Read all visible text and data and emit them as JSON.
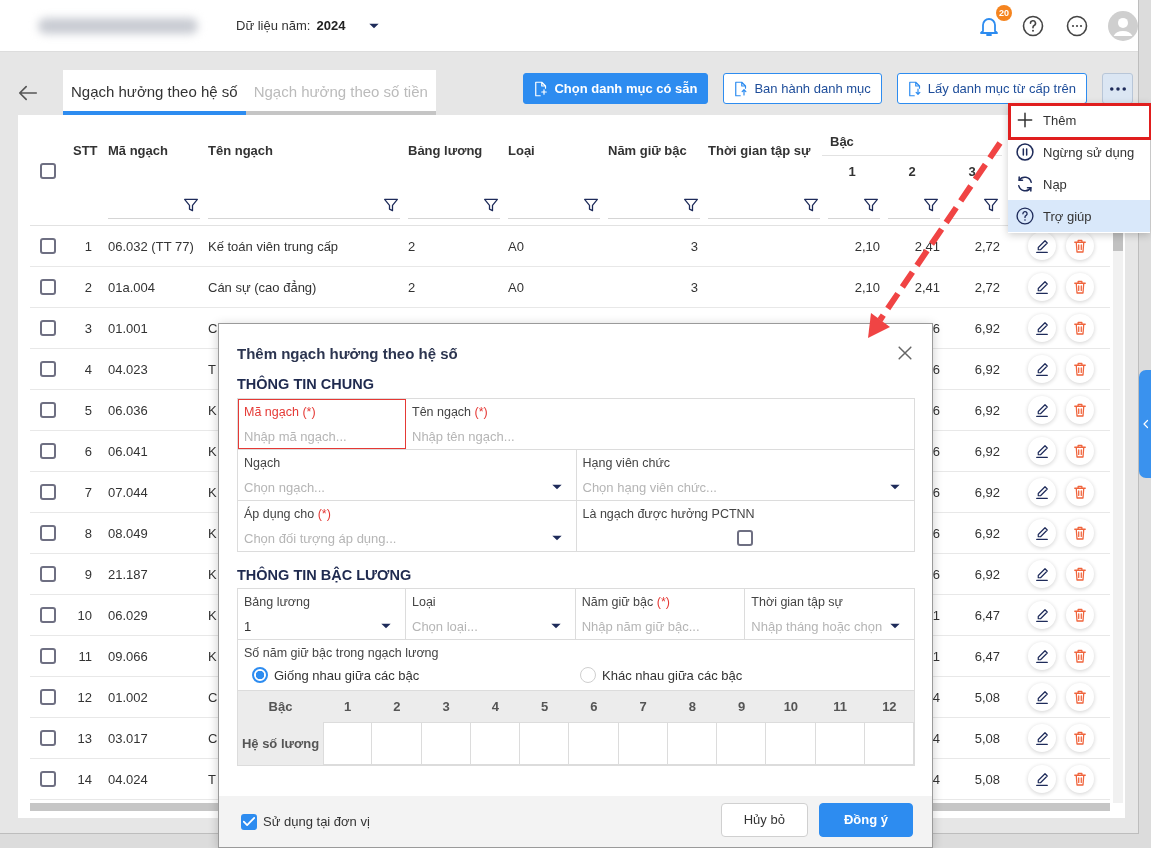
{
  "header": {
    "year_label": "Dữ liệu năm:",
    "year": "2024",
    "notification_count": "20"
  },
  "toolbar": {
    "tabs": [
      {
        "label": "Ngạch hưởng theo hệ số",
        "selected": true
      },
      {
        "label": "Ngạch hưởng theo số tiền",
        "selected": false
      }
    ],
    "buttons": [
      {
        "label": "Chọn danh mục có sẵn",
        "kind": "primary"
      },
      {
        "label": "Ban hành danh mục",
        "kind": "outline"
      },
      {
        "label": "Lấy danh mục từ cấp trên",
        "kind": "outline"
      }
    ]
  },
  "more_menu": {
    "items": [
      {
        "label": "Thêm",
        "hovered": false,
        "annotated": true
      },
      {
        "label": "Ngừng sử dụng",
        "hovered": false,
        "annotated": false
      },
      {
        "label": "Nạp",
        "hovered": false,
        "annotated": false
      },
      {
        "label": "Trợ giúp",
        "hovered": true,
        "annotated": false
      }
    ]
  },
  "table": {
    "select_all_checked": false,
    "columns": [
      "STT",
      "Mã ngạch",
      "Tên ngạch",
      "Bảng lương",
      "Loại",
      "Năm giữ bậc",
      "Thời gian tập sự"
    ],
    "step_header": "Bậc",
    "steps": [
      "1",
      "2",
      "3"
    ],
    "rows": [
      {
        "checked": false,
        "stt": "1",
        "code": "06.032 (TT 77)",
        "name": "Kế toán viên trung cấp",
        "salary_table": "2",
        "type": "A0",
        "years": "3",
        "step_1": "2,10",
        "step_2": "2,41",
        "step_3": "2,72"
      },
      {
        "checked": false,
        "stt": "2",
        "code": "01a.004",
        "name": "Cán sự (cao đẳng)",
        "salary_table": "2",
        "type": "A0",
        "years": "3",
        "step_1": "2,10",
        "step_2": "2,41",
        "step_3": "2,72"
      },
      {
        "checked": false,
        "stt": "3",
        "code": "01.001",
        "name": "C",
        "step_2": "6",
        "step_3": "6,92"
      },
      {
        "checked": false,
        "stt": "4",
        "code": "04.023",
        "name": "T",
        "step_2": "6",
        "step_3": "6,92"
      },
      {
        "checked": false,
        "stt": "5",
        "code": "06.036",
        "name": "K",
        "step_2": "6",
        "step_3": "6,92"
      },
      {
        "checked": false,
        "stt": "6",
        "code": "06.041",
        "name": "K",
        "step_2": "6",
        "step_3": "6,92"
      },
      {
        "checked": false,
        "stt": "7",
        "code": "07.044",
        "name": "K",
        "step_2": "6",
        "step_3": "6,92"
      },
      {
        "checked": false,
        "stt": "8",
        "code": "08.049",
        "name": "K",
        "step_2": "6",
        "step_3": "6,92"
      },
      {
        "checked": false,
        "stt": "9",
        "code": "21.187",
        "name": "K",
        "step_2": "6",
        "step_3": "6,92"
      },
      {
        "checked": false,
        "stt": "10",
        "code": "06.029",
        "name": "K",
        "step_2": "1",
        "step_3": "6,47"
      },
      {
        "checked": false,
        "stt": "11",
        "code": "09.066",
        "name": "K",
        "step_2": "1",
        "step_3": "6,47"
      },
      {
        "checked": false,
        "stt": "12",
        "code": "01.002",
        "name": "C",
        "step_2": "4",
        "step_3": "5,08"
      },
      {
        "checked": false,
        "stt": "13",
        "code": "03.017",
        "name": "C",
        "step_2": "4",
        "step_3": "5,08"
      },
      {
        "checked": false,
        "stt": "14",
        "code": "04.024",
        "name": "T",
        "step_2": "4",
        "step_3": "5,08"
      }
    ]
  },
  "dialog": {
    "title": "Thêm ngạch hưởng theo hệ số",
    "sections": [
      {
        "title": "THÔNG TIN CHUNG",
        "rows": [
          {
            "fields": [
              {
                "kind": "text",
                "label": "Mã ngạch",
                "required_mark": "(*)",
                "placeholder": "Nhập mã ngạch...",
                "focused": true
              },
              {
                "kind": "text",
                "label": "Tên ngạch",
                "required_mark": "(*)",
                "placeholder": "Nhập tên ngạch...",
                "focused": false
              }
            ]
          },
          {
            "fields": [
              {
                "kind": "select",
                "label": "Ngạch",
                "placeholder": "Chọn ngạch...",
                "focused": false
              },
              {
                "kind": "select",
                "label": "Hạng viên chức",
                "placeholder": "Chọn hạng viên chức...",
                "focused": false
              }
            ]
          },
          {
            "fields": [
              {
                "kind": "select",
                "label": "Áp dụng cho",
                "required_mark": "(*)",
                "placeholder": "Chọn đối tượng áp dụng...",
                "focused": false
              },
              {
                "kind": "checkbox",
                "label": "Là ngạch được hưởng PCTNN",
                "checked": false,
                "focused": false
              }
            ]
          }
        ]
      },
      {
        "title": "THÔNG TIN BẬC LƯƠNG",
        "rows": [
          {
            "fields": [
              {
                "kind": "select",
                "label": "Bảng lương",
                "value": "1",
                "focused": false
              },
              {
                "kind": "select",
                "label": "Loại",
                "placeholder": "Chọn loại...",
                "focused": false
              },
              {
                "kind": "text",
                "label": "Năm giữ bậc",
                "required_mark": "(*)",
                "placeholder": "Nhập năm giữ bậc...",
                "focused": false
              },
              {
                "kind": "select",
                "label": "Thời gian tập sự",
                "placeholder": "Nhập tháng hoặc chọn",
                "focused": false
              }
            ]
          }
        ],
        "radio_group": {
          "label": "Số năm giữ bậc trong ngạch lương",
          "options": [
            {
              "label": "Giống nhau giữa các bậc",
              "selected": true
            },
            {
              "label": "Khác nhau giữa các bậc",
              "selected": false
            }
          ]
        },
        "step_grid": {
          "header_label": "Bậc",
          "row_label": "Hệ số lương",
          "steps": [
            "1",
            "2",
            "3",
            "4",
            "5",
            "6",
            "7",
            "8",
            "9",
            "10",
            "11",
            "12"
          ]
        }
      }
    ],
    "footer": {
      "use_at_unit": {
        "label": "Sử dụng tại đơn vị",
        "checked": true
      },
      "buttons": [
        {
          "label": "Hủy bỏ",
          "kind": "secondary"
        },
        {
          "label": "Đồng ý",
          "kind": "primary"
        }
      ]
    }
  }
}
